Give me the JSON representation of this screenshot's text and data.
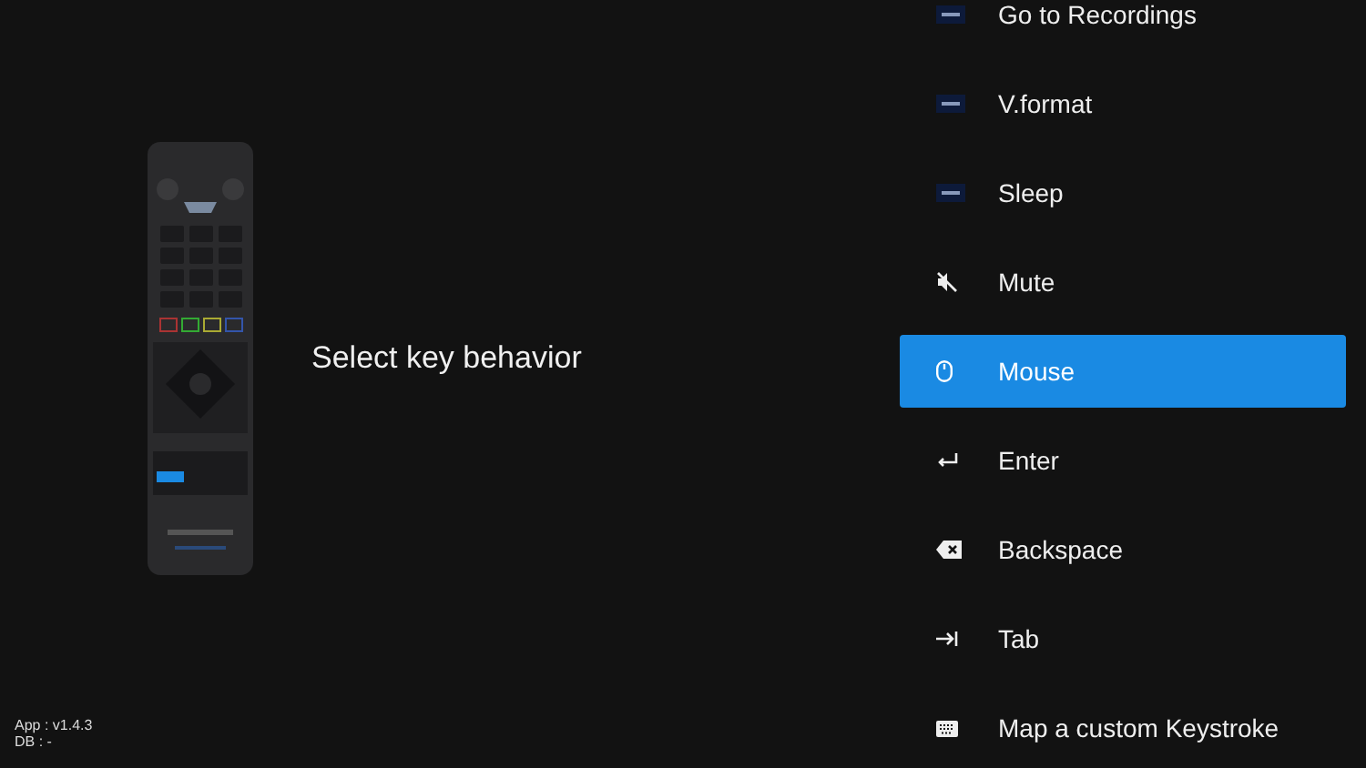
{
  "prompt": "Select key behavior",
  "version": {
    "app": "App : v1.4.3",
    "db": "DB : -"
  },
  "options": [
    {
      "label": "Go to Recordings",
      "selected": false
    },
    {
      "label": "V.format",
      "selected": false
    },
    {
      "label": "Sleep",
      "selected": false
    },
    {
      "label": "Mute",
      "selected": false
    },
    {
      "label": "Mouse",
      "selected": true
    },
    {
      "label": "Enter",
      "selected": false
    },
    {
      "label": "Backspace",
      "selected": false
    },
    {
      "label": "Tab",
      "selected": false
    },
    {
      "label": "Map a custom Keystroke",
      "selected": false
    }
  ]
}
